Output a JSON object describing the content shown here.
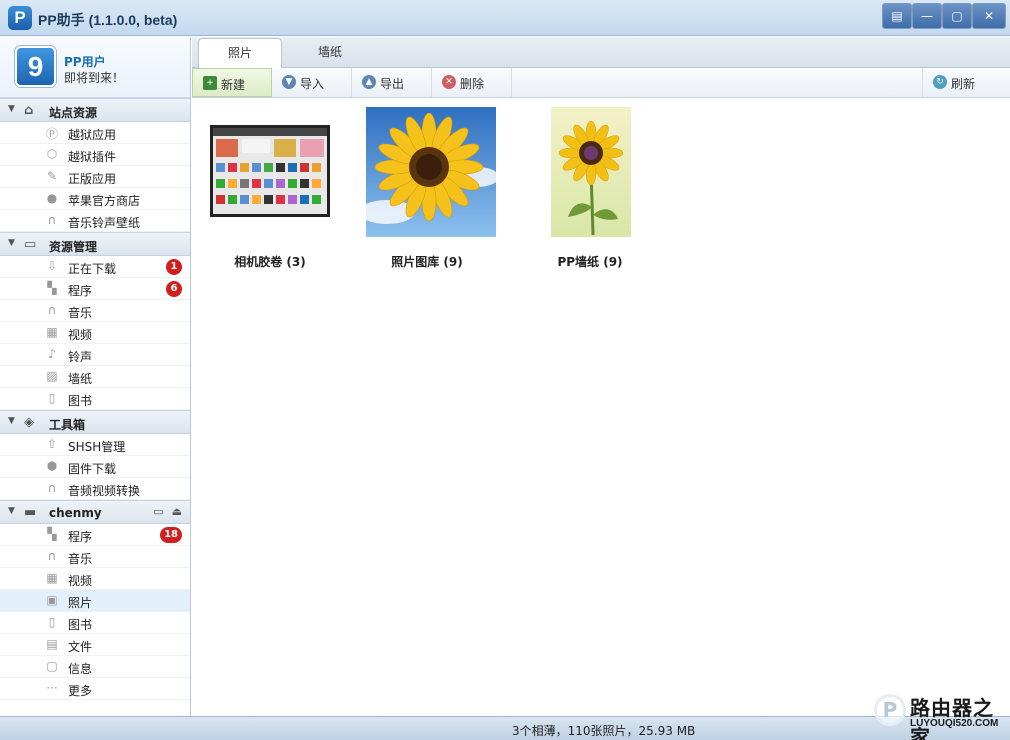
{
  "window": {
    "logo_letter": "P",
    "title": "PP助手 (1.1.0.0, beta)",
    "controls": {
      "skin": "▤",
      "minimize": "—",
      "maximize": "▢",
      "close": "✕"
    }
  },
  "user": {
    "avatar_letter": "9",
    "name": "PP用户",
    "status": "即将到来！"
  },
  "sidebar": {
    "groups": [
      {
        "label": "站点资源",
        "icon": "home-icon",
        "items": [
          {
            "label": "越狱应用",
            "icon": "p-app-icon"
          },
          {
            "label": "越狱插件",
            "icon": "cube-icon"
          },
          {
            "label": "正版应用",
            "icon": "app-store-icon"
          },
          {
            "label": "苹果官方商店",
            "icon": "apple-icon"
          },
          {
            "label": "音乐铃声壁纸",
            "icon": "headphones-icon"
          }
        ]
      },
      {
        "label": "资源管理",
        "icon": "monitor-icon",
        "items": [
          {
            "label": "正在下载",
            "icon": "download-icon",
            "badge": "1"
          },
          {
            "label": "程序",
            "icon": "grid-icon",
            "badge": "6"
          },
          {
            "label": "音乐",
            "icon": "headphones-icon"
          },
          {
            "label": "视频",
            "icon": "film-icon"
          },
          {
            "label": "铃声",
            "icon": "note-icon"
          },
          {
            "label": "墙纸",
            "icon": "image-icon"
          },
          {
            "label": "图书",
            "icon": "book-icon"
          }
        ]
      },
      {
        "label": "工具箱",
        "icon": "toolbox-icon",
        "items": [
          {
            "label": "SHSH管理",
            "icon": "shsh-icon"
          },
          {
            "label": "固件下载",
            "icon": "firmware-icon"
          },
          {
            "label": "音频视频转换",
            "icon": "convert-icon"
          }
        ]
      },
      {
        "label": "chenmy",
        "icon": "device-icon",
        "tools": [
          "battery-icon",
          "eject-icon"
        ],
        "items": [
          {
            "label": "程序",
            "icon": "grid-icon",
            "badge": "18"
          },
          {
            "label": "音乐",
            "icon": "headphones-icon"
          },
          {
            "label": "视频",
            "icon": "film-icon"
          },
          {
            "label": "照片",
            "icon": "photo-icon",
            "selected": true
          },
          {
            "label": "图书",
            "icon": "book-icon"
          },
          {
            "label": "文件",
            "icon": "folder-icon"
          },
          {
            "label": "信息",
            "icon": "message-icon"
          },
          {
            "label": "更多",
            "icon": "more-icon"
          }
        ]
      }
    ]
  },
  "tabs": [
    {
      "label": "照片",
      "active": true
    },
    {
      "label": "墙纸",
      "active": false
    }
  ],
  "toolbar": {
    "new_label": "新建",
    "import_label": "导入",
    "export_label": "导出",
    "delete_label": "删除",
    "refresh_label": "刷新"
  },
  "albums": [
    {
      "label": "相机胶卷 (3)",
      "thumb": "screenshot-thumbnail"
    },
    {
      "label": "照片图库 (9)",
      "thumb": "sunflower-sky-thumbnail"
    },
    {
      "label": "PP墙纸 (9)",
      "thumb": "sunflower-wallpaper-thumbnail"
    }
  ],
  "status": {
    "text": "3个相薄，110张照片，25.93 MB"
  },
  "watermark": {
    "name": "路由器之家",
    "url": "LUYOUQI520.COM",
    "letter": "P"
  },
  "colors": {
    "accent": "#1a6fb5",
    "badge": "#d11f1f",
    "selected_row": "#e3effa"
  }
}
